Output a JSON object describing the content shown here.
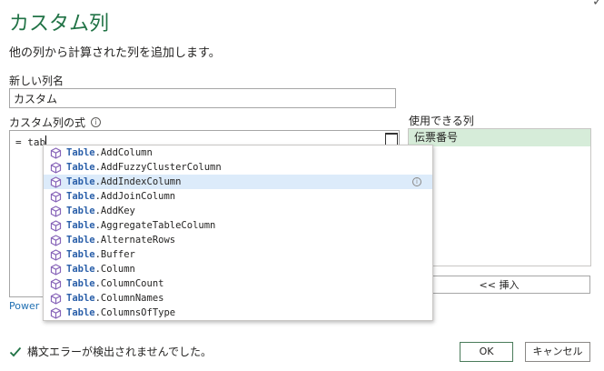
{
  "dialog": {
    "title": "カスタム列",
    "subtitle": "他の列から計算された列を追加します。",
    "corner_glyph": "✓"
  },
  "new_column": {
    "label": "新しい列名",
    "value": "カスタム"
  },
  "formula": {
    "label": "カスタム列の式",
    "text": "= tab"
  },
  "available_columns": {
    "label": "使用できる列",
    "items": [
      "伝票番号"
    ]
  },
  "insert_button": "<< 挿入",
  "power_link": "Power",
  "autocomplete": {
    "prefix": "Table",
    "items": [
      ".AddColumn",
      ".AddFuzzyClusterColumn",
      ".AddIndexColumn",
      ".AddJoinColumn",
      ".AddKey",
      ".AggregateTableColumn",
      ".AlternateRows",
      ".Buffer",
      ".Column",
      ".ColumnCount",
      ".ColumnNames",
      ".ColumnsOfType"
    ],
    "highlighted_index": 2
  },
  "status": {
    "text": "構文エラーが検出されませんでした。"
  },
  "buttons": {
    "ok": "OK",
    "cancel": "キャンセル"
  },
  "colors": {
    "title": "#217346",
    "selected_item": "#d6ecd9",
    "highlight": "#dcebfa",
    "link": "#1f6fb2"
  }
}
